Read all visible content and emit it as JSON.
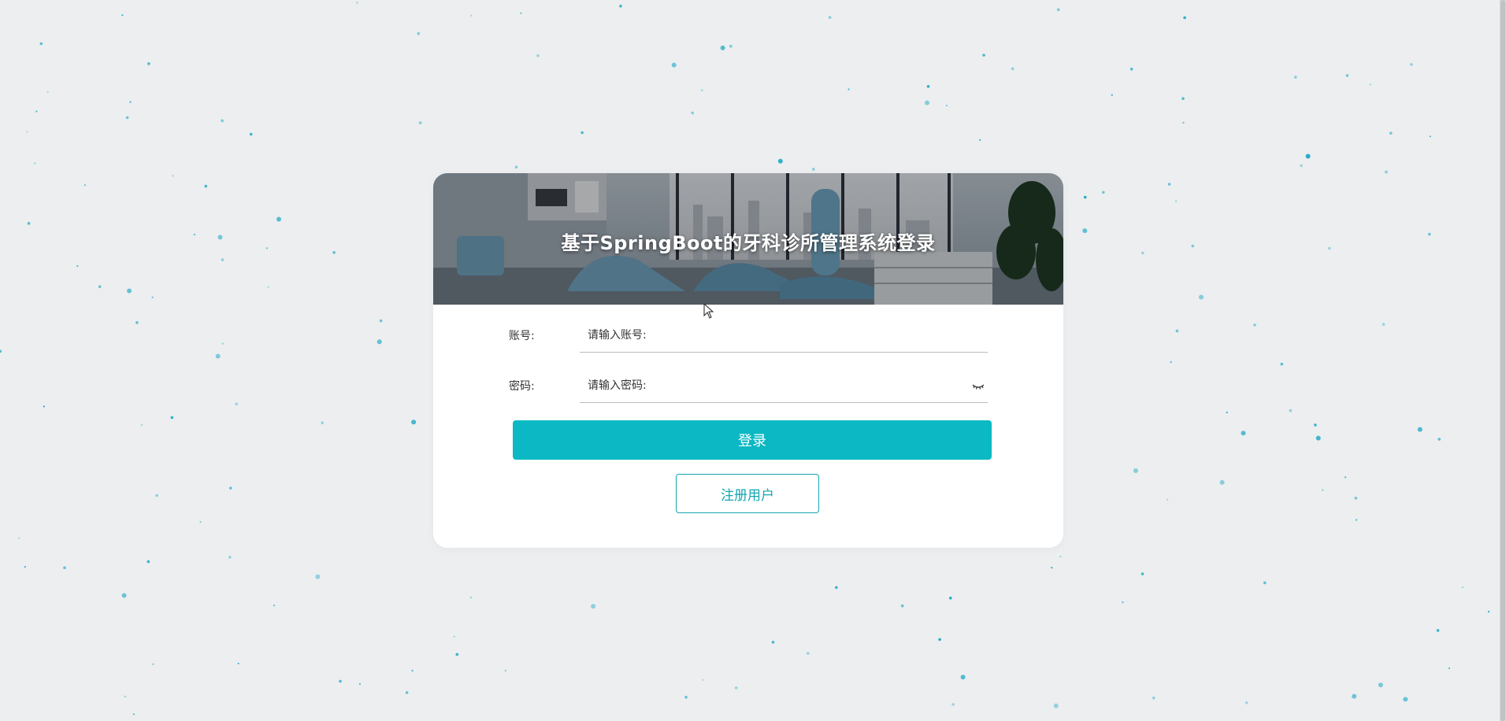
{
  "colors": {
    "background": "#eceef0",
    "accent": "#0bb8c3",
    "register_border": "#13a6b0",
    "dot": "#1aa7c4"
  },
  "login": {
    "title": "基于SpringBoot的牙科诊所管理系统登录",
    "account_label": "账号:",
    "account_placeholder": "请输入账号:",
    "password_label": "密码:",
    "password_placeholder": "请输入密码:",
    "password_toggle_icon": "eye-closed-icon",
    "login_button": "登录",
    "register_button": "注册用户"
  },
  "banner_icon": "dental-clinic-photo"
}
